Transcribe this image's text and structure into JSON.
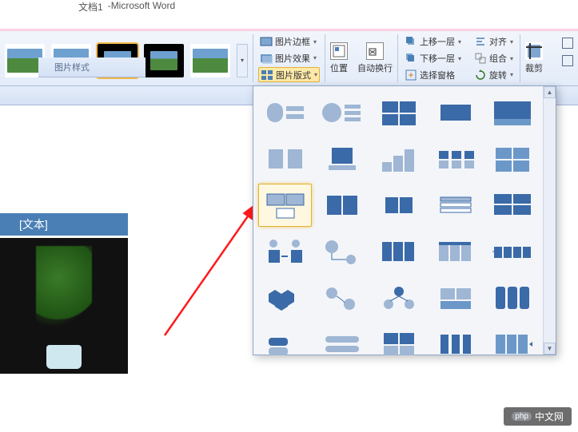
{
  "app": {
    "title_doc": "文档1",
    "title_app": "Microsoft Word"
  },
  "ribbon": {
    "styles_label": "图片样式",
    "border_label": "图片边框",
    "effects_label": "图片效果",
    "layout_label": "图片版式",
    "position_label": "位置",
    "wrap_label": "自动换行",
    "forward_label": "上移一层",
    "backward_label": "下移一层",
    "selection_label": "选择窗格",
    "align_label": "对齐",
    "group_label": "组合",
    "rotate_label": "旋转",
    "crop_label": "裁剪"
  },
  "smartart": {
    "caption": "[文本]"
  },
  "watermark": {
    "brand": "php",
    "text": "中文网"
  },
  "colors": {
    "accent": "#4a7fb5",
    "highlight": "#ffe9a8",
    "panel": "#f3f5f9"
  },
  "layout_options": {
    "selected_index": 10,
    "count": 30
  }
}
